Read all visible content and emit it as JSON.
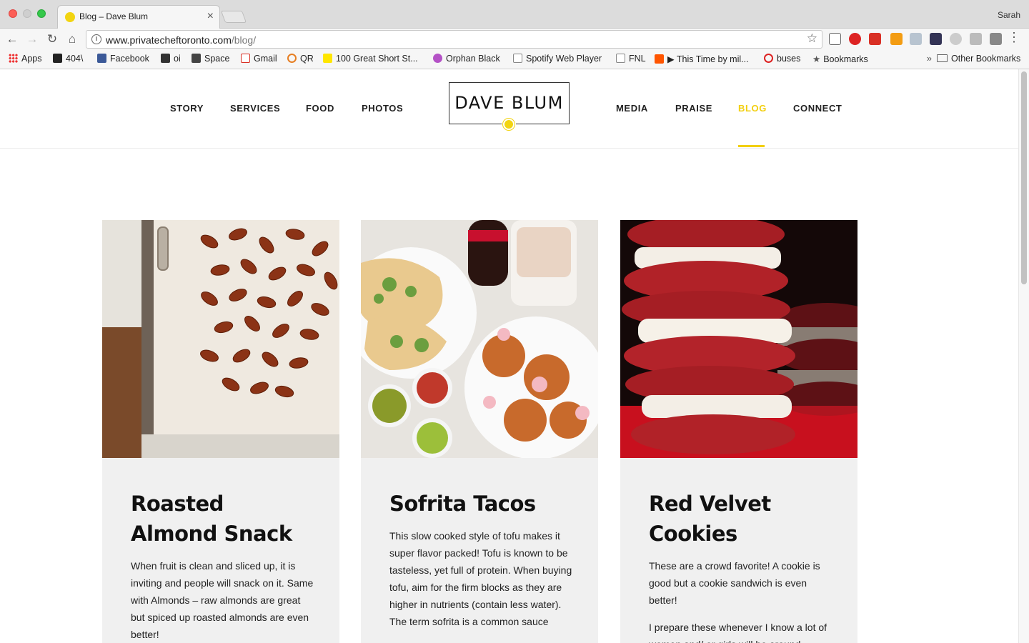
{
  "browser": {
    "tab_title": "Blog – Dave Blum",
    "profile_name": "Sarah",
    "url_host": "www.privatecheftoronto.com",
    "url_path": "/blog/",
    "bookmarks": [
      {
        "label": "Apps"
      },
      {
        "label": "404\\"
      },
      {
        "label": "Facebook"
      },
      {
        "label": "oi"
      },
      {
        "label": "Space"
      },
      {
        "label": "Gmail"
      },
      {
        "label": "QR"
      },
      {
        "label": "100 Great Short St..."
      },
      {
        "label": "Orphan Black"
      },
      {
        "label": "Spotify Web Player"
      },
      {
        "label": "FNL"
      },
      {
        "label": "▶ This Time by mil..."
      },
      {
        "label": "buses"
      },
      {
        "label": "Bookmarks"
      }
    ],
    "overflow": "»",
    "other_bookmarks": "Other Bookmarks"
  },
  "site": {
    "nav_left": [
      "STORY",
      "SERVICES",
      "FOOD",
      "PHOTOS"
    ],
    "logo_text": "DAVE  BLUM",
    "nav_right": [
      "MEDIA",
      "PRAISE",
      "BLOG",
      "CONNECT"
    ],
    "active_nav": "BLOG",
    "accent_color": "#f2cf10"
  },
  "posts": [
    {
      "title": "Roasted Almond Snack",
      "paragraphs": [
        "When fruit is clean and sliced up, it is inviting and people will snack on it. Same with Almonds – raw almonds are great but spiced up roasted almonds are even better!"
      ]
    },
    {
      "title": "Sofrita Tacos",
      "paragraphs": [
        "This slow cooked style of tofu makes it super flavor packed! Tofu is known to be tasteless, yet full of protein. When buying tofu, aim for the firm blocks as they are higher in nutrients (contain less water).",
        "The term sofrita is a common sauce"
      ]
    },
    {
      "title": "Red Velvet Cookies",
      "paragraphs": [
        "These are a crowd favorite! A cookie is good but a cookie sandwich is even better!",
        "I prepare these whenever I know a lot of women and/ or girls will be around"
      ]
    }
  ]
}
